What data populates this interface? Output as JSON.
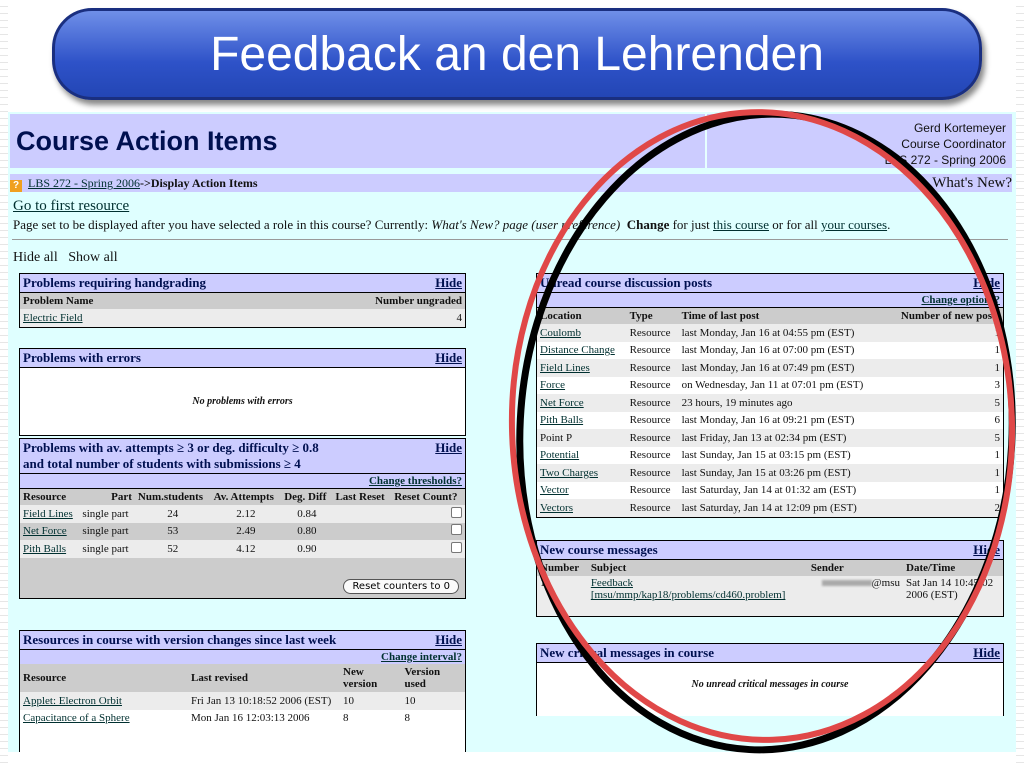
{
  "slide_title": "Feedback an den Lehrenden",
  "header": {
    "title": "Course Action Items",
    "user_name": "Gerd Kortemeyer",
    "role": "Course Coordinator",
    "course": "LBS 272 - Spring 2006"
  },
  "breadcrumb": {
    "course_link": "LBS 272 - Spring 2006",
    "current": "->Display Action Items",
    "help": "What's New?"
  },
  "first_resource_link": "Go to first resource",
  "pref": {
    "text": "Page set to be displayed after you have selected a role in this course? Currently: ",
    "current": "What's New? page (user preference)",
    "change": "Change",
    "mid": " for just ",
    "this_course": "this course",
    "or": " or for all ",
    "your_courses": "your courses",
    "end": "."
  },
  "hide_all": "Hide all",
  "show_all": "Show all",
  "hide": "Hide",
  "handgrading": {
    "title": "Problems requiring handgrading",
    "cols": [
      "Problem Name",
      "Number ungraded"
    ],
    "rows": [
      [
        "Electric Field",
        "4"
      ]
    ]
  },
  "errors": {
    "title": "Problems with errors",
    "empty": "No problems with errors"
  },
  "difficulty": {
    "title1": "Problems with av. attempts ≥ 3 or deg. difficulty ≥ 0.8",
    "title2": "and total number of students with submissions ≥ 4",
    "change": "Change thresholds?",
    "cols": [
      "Resource",
      "Part",
      "Num.students",
      "Av. Attempts",
      "Deg. Diff",
      "Last Reset",
      "Reset Count?"
    ],
    "rows": [
      [
        "Field Lines",
        "single part",
        "24",
        "2.12",
        "0.84",
        ""
      ],
      [
        "Net Force",
        "single part",
        "53",
        "2.49",
        "0.80",
        ""
      ],
      [
        "Pith Balls",
        "single part",
        "52",
        "4.12",
        "0.90",
        ""
      ]
    ],
    "reset_button": "Reset counters to 0"
  },
  "versions": {
    "title": "Resources in course with version changes since last week",
    "change": "Change interval?",
    "cols": [
      "Resource",
      "Last revised",
      "New version",
      "Version used"
    ],
    "rows": [
      [
        "Applet: Electron Orbit",
        "Fri Jan 13 10:18:52 2006 (EST)",
        "10",
        "10"
      ],
      [
        "Capacitance of a Sphere",
        "Mon Jan 16 12:03:13 2006",
        "8",
        "8"
      ]
    ]
  },
  "discussion": {
    "title": "Unread course discussion posts",
    "change": "Change options?",
    "cols": [
      "Location",
      "Type",
      "Time of last post",
      "Number of new posts"
    ],
    "rows": [
      [
        "Coulomb",
        "Resource",
        "last Monday, Jan 16 at 04:55 pm (EST)",
        "1"
      ],
      [
        "Distance Change",
        "Resource",
        "last Monday, Jan 16 at 07:00 pm (EST)",
        "1"
      ],
      [
        "Field Lines",
        "Resource",
        "last Monday, Jan 16 at 07:49 pm (EST)",
        "1"
      ],
      [
        "Force",
        "Resource",
        "on Wednesday, Jan 11 at 07:01 pm (EST)",
        "3"
      ],
      [
        "Net Force",
        "Resource",
        "23 hours, 19 minutes ago",
        "5"
      ],
      [
        "Pith Balls",
        "Resource",
        "last Monday, Jan 16 at 09:21 pm (EST)",
        "6"
      ],
      [
        "Point P",
        "Resource",
        "last Friday, Jan 13 at 02:34 pm (EST)",
        "5"
      ],
      [
        "Potential",
        "Resource",
        "last Sunday, Jan 15 at 03:15 pm (EST)",
        "1"
      ],
      [
        "Two Charges",
        "Resource",
        "last Sunday, Jan 15 at 03:26 pm (EST)",
        "1"
      ],
      [
        "Vector",
        "Resource",
        "last Saturday, Jan 14 at 01:32 am (EST)",
        "1"
      ],
      [
        "Vectors",
        "Resource",
        "last Saturday, Jan 14 at 12:09 pm (EST)",
        "2"
      ]
    ]
  },
  "messages": {
    "title": "New course messages",
    "cols": [
      "Number",
      "Subject",
      "Sender",
      "Date/Time"
    ],
    "rows": [
      [
        "1.",
        "Feedback [msu/mmp/kap18/problems/cd460.problem]",
        "@msu",
        "Sat Jan 14 10:45:02 2006 (EST)"
      ]
    ]
  },
  "critical": {
    "title": "New critical messages in course",
    "empty": "No unread critical messages in course"
  },
  "colors": {
    "header": "#ccccff",
    "page": "#dfffff",
    "circle_red": "#e04848",
    "circle_black": "#000000",
    "title_bar": "#2e52c8"
  }
}
